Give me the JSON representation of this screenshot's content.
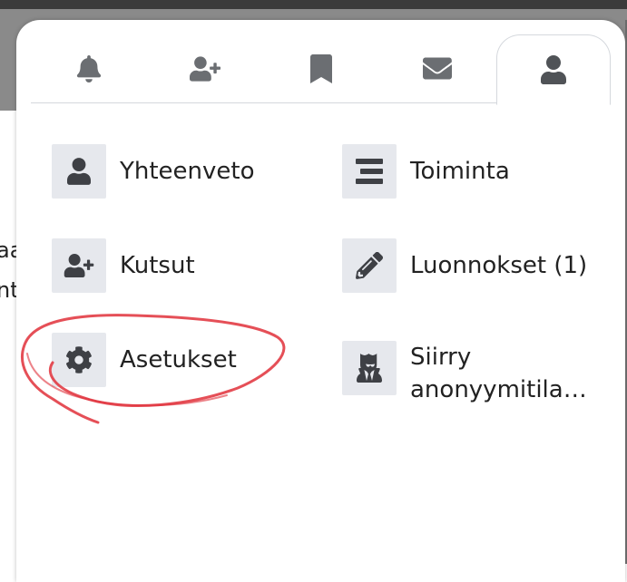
{
  "background": {
    "header_fragment": "",
    "text_fragment_1": "aa",
    "text_fragment_2": "nt"
  },
  "tabs": [
    {
      "icon": "bell-icon",
      "active": false
    },
    {
      "icon": "user-plus-icon",
      "active": false
    },
    {
      "icon": "bookmark-icon",
      "active": false
    },
    {
      "icon": "envelope-icon",
      "active": false
    },
    {
      "icon": "user-icon",
      "active": true
    }
  ],
  "menu": {
    "summary": {
      "label": "Yhteenveto",
      "icon": "user-icon"
    },
    "activity": {
      "label": "Toiminta",
      "icon": "stream-icon"
    },
    "invites": {
      "label": "Kutsut",
      "icon": "user-plus-icon"
    },
    "drafts": {
      "label": "Luonnokset (1)",
      "icon": "pencil-icon"
    },
    "settings": {
      "label": "Asetukset",
      "icon": "gear-icon"
    },
    "anonymous": {
      "label": "Siirry anonyymitila…",
      "icon": "user-secret-icon"
    }
  },
  "annotation": {
    "color": "#e0303a"
  }
}
